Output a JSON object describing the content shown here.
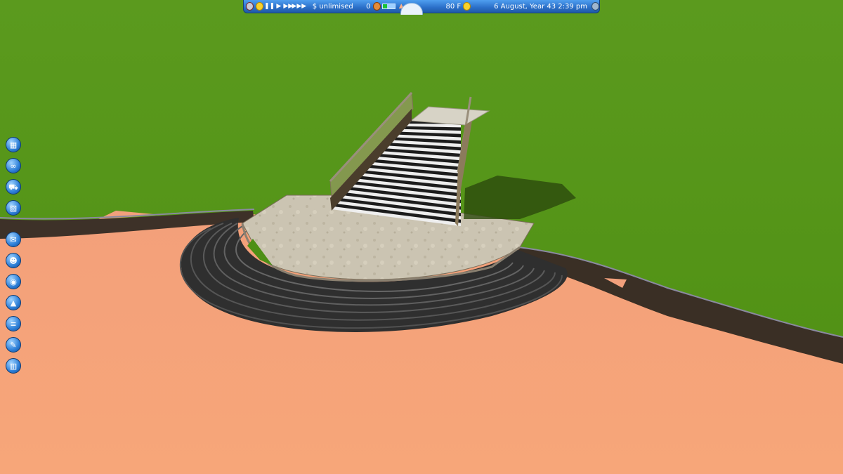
{
  "top_bar": {
    "money": "$ unlimised",
    "guests": "0",
    "park_rating": 0.35,
    "temperature": "80 F",
    "date": "6 August, Year 43  2:39 pm",
    "icons": [
      "camera-icon",
      "sun-speed-icon",
      "pause-icon",
      "play-icon",
      "fast-forward-icon",
      "fastest-forward-icon",
      "guests-icon",
      "park-rating-icon",
      "weather-sun-icon",
      "options-icon"
    ]
  },
  "toolbar": {
    "tools": [
      {
        "name": "park-management-icon",
        "glyph": "▦"
      },
      {
        "name": "rides-icon",
        "glyph": "∞"
      },
      {
        "name": "shops-stalls-icon",
        "glyph": "⛟"
      },
      {
        "name": "scenery-icon",
        "glyph": "▧"
      },
      {
        "name": "messages-icon",
        "glyph": "✉"
      },
      {
        "name": "staff-icon",
        "glyph": "☻"
      },
      {
        "name": "view-options-icon",
        "glyph": "◉"
      },
      {
        "name": "terrain-icon",
        "glyph": "▲"
      },
      {
        "name": "paths-icon",
        "glyph": "≡"
      },
      {
        "name": "tools-icon",
        "glyph": "✎"
      },
      {
        "name": "delete-icon",
        "glyph": "▥"
      }
    ]
  },
  "colors": {
    "grass": "#5a9a1c",
    "sand": "#f5a07a",
    "wall": "#3c3026",
    "steps": "#3a3a3a",
    "platform": "#c9c2b0"
  }
}
